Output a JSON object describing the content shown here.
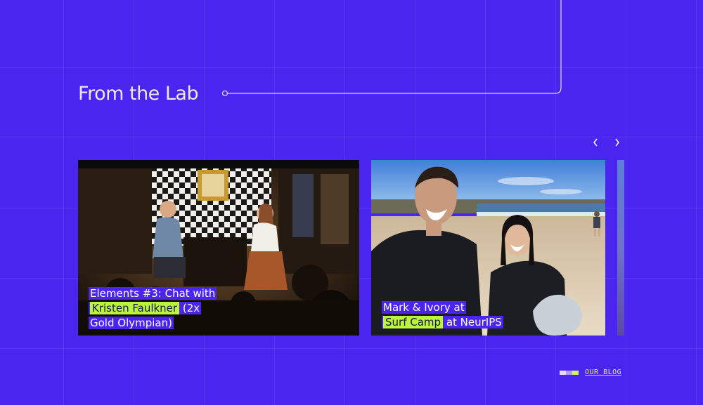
{
  "section": {
    "title": "From the Lab"
  },
  "carousel": {
    "prev_icon": "chevron-left-icon",
    "next_icon": "chevron-right-icon",
    "cards": [
      {
        "lines": [
          {
            "before": "Elements #3: Chat with",
            "highlight": "",
            "after": ""
          },
          {
            "before": "",
            "highlight": "Kristen Faulkner",
            "after": " (2x"
          },
          {
            "before": "Gold Olympian)",
            "highlight": "",
            "after": ""
          }
        ]
      },
      {
        "lines": [
          {
            "before": "Mark & Ivory at",
            "highlight": "",
            "after": ""
          },
          {
            "before": "",
            "highlight": "Surf Camp",
            "after": " at NeurIPS"
          }
        ]
      }
    ]
  },
  "footer": {
    "blog_label": "OUR BLOG"
  },
  "colors": {
    "background": "#4a25f0",
    "highlight": "#b9f53c",
    "link": "#c9ff4a"
  }
}
